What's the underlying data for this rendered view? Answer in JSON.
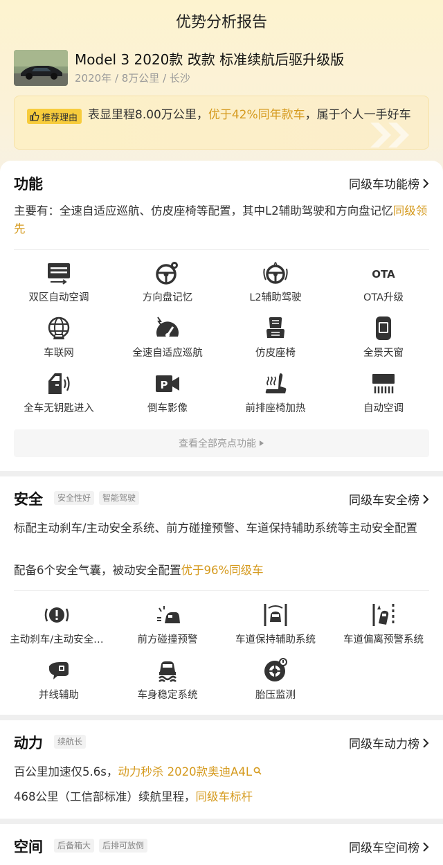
{
  "header": {
    "title": "优势分析报告",
    "car_title": "Model 3 2020款 改款 标准续航后驱升级版",
    "car_meta": "2020年 / 8万公里 / 长沙"
  },
  "reason": {
    "tag": "推荐理由",
    "text_a": "表显里程8.00万公里，",
    "text_hl": "优于42%同年款车",
    "text_b": "，属于个人一手好车"
  },
  "function": {
    "title": "功能",
    "link": "同级车功能榜",
    "desc_a": "主要有：全速自适应巡航、仿皮座椅等配置，其中L2辅助驾驶和方向盘记忆",
    "desc_hl": "同级领先",
    "features": [
      {
        "label": "双区自动空调",
        "icon": "dual-zone-ac-icon"
      },
      {
        "label": "方向盘记忆",
        "icon": "steering-memory-icon"
      },
      {
        "label": "L2辅助驾驶",
        "icon": "l2-assist-icon"
      },
      {
        "label": "OTA升级",
        "icon": "ota-icon",
        "glyph": "OTA"
      },
      {
        "label": "车联网",
        "icon": "connected-car-icon"
      },
      {
        "label": "全速自适应巡航",
        "icon": "adaptive-cruise-icon"
      },
      {
        "label": "仿皮座椅",
        "icon": "leather-seat-icon"
      },
      {
        "label": "全景天窗",
        "icon": "panoramic-roof-icon"
      },
      {
        "label": "全车无钥匙进入",
        "icon": "keyless-entry-icon"
      },
      {
        "label": "倒车影像",
        "icon": "reverse-camera-icon",
        "glyph": "P"
      },
      {
        "label": "前排座椅加热",
        "icon": "seat-heating-icon"
      },
      {
        "label": "自动空调",
        "icon": "auto-ac-icon"
      }
    ],
    "more": "查看全部亮点功能"
  },
  "safety": {
    "title": "安全",
    "tags": [
      "安全性好",
      "智能驾驶"
    ],
    "link": "同级车安全榜",
    "desc1": "标配主动刹车/主动安全系统、前方碰撞预警、车道保持辅助系统等主动安全配置",
    "desc2_a": "配备6个安全气囊，被动安全配置",
    "desc2_hl": "优于96%同级车",
    "features": [
      {
        "label": "主动刹车/主动安全…",
        "icon": "active-brake-icon"
      },
      {
        "label": "前方碰撞预警",
        "icon": "collision-warning-icon"
      },
      {
        "label": "车道保持辅助系统",
        "icon": "lane-keep-icon"
      },
      {
        "label": "车道偏离预警系统",
        "icon": "lane-departure-icon"
      },
      {
        "label": "并线辅助",
        "icon": "blind-spot-icon"
      },
      {
        "label": "车身稳定系统",
        "icon": "stability-control-icon"
      },
      {
        "label": "胎压监测",
        "icon": "tire-pressure-icon"
      }
    ]
  },
  "power": {
    "title": "动力",
    "tags": [
      "续航长"
    ],
    "link": "同级车动力榜",
    "line1_a": "百公里加速仅5.6s，",
    "line1_hl": "动力秒杀 2020款奥迪A4L",
    "line2_a": "468公里（工信部标准）续航里程，",
    "line2_hl": "同级车标杆"
  },
  "space": {
    "title": "空间",
    "tags": [
      "后备箱大",
      "后排可放倒"
    ],
    "link": "同级车空间榜"
  },
  "colors": {
    "accent": "#d59a1e",
    "tag_yellow": "#f7cc3c",
    "hero_bg": "#fdf3cf"
  }
}
